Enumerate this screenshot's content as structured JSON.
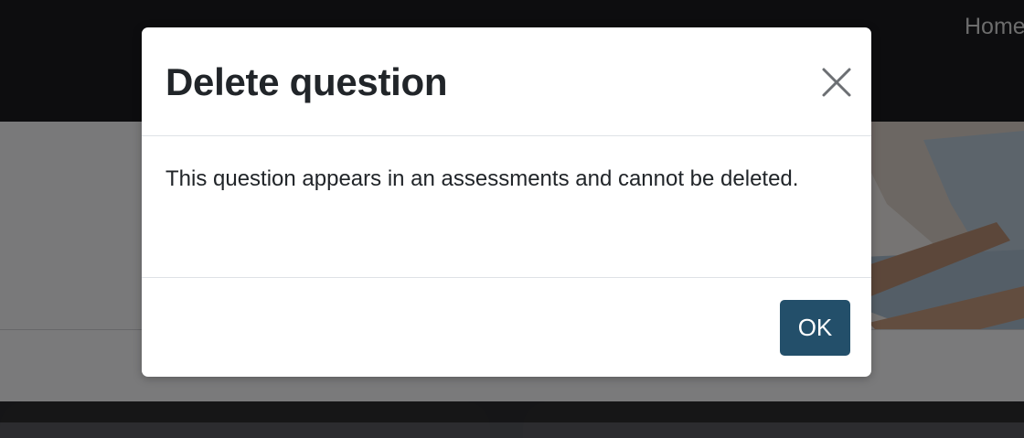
{
  "navbar": {
    "home_label": "Home"
  },
  "modal": {
    "title": "Delete question",
    "close_icon": "close-icon",
    "message": "This question appears in an assessments and cannot be deleted.",
    "ok_label": "OK"
  },
  "colors": {
    "primary_button": "#234f6a",
    "navbar_background": "#1a1b1f",
    "overlay": "rgba(0,0,0,0.5)"
  }
}
